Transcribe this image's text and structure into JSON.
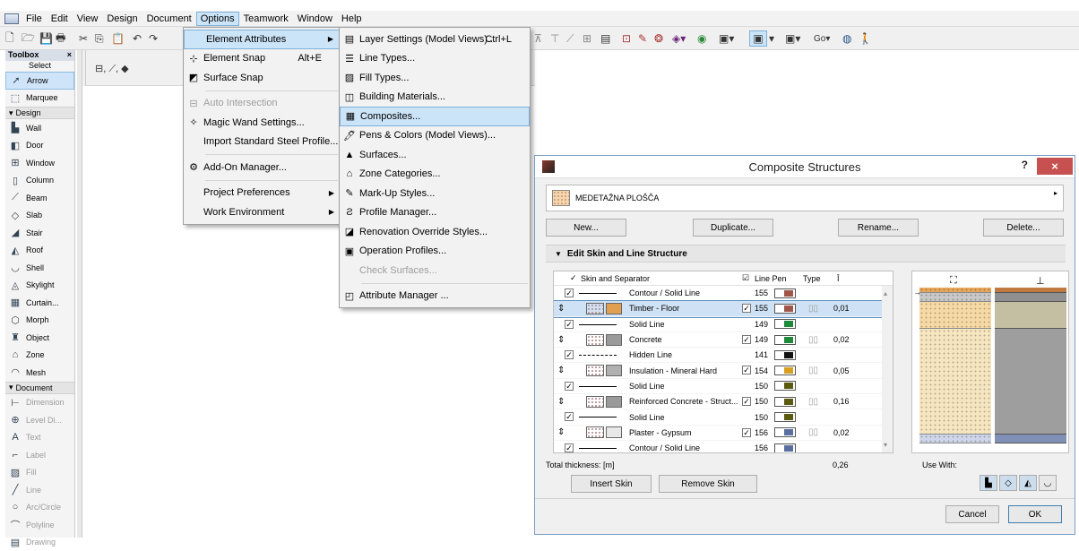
{
  "menubar": {
    "items": [
      "File",
      "Edit",
      "View",
      "Design",
      "Document",
      "Options",
      "Teamwork",
      "Window",
      "Help"
    ]
  },
  "toolbox": {
    "title": "Toolbox",
    "select": "Select",
    "items": [
      {
        "label": "Arrow",
        "sel": true
      },
      {
        "label": "Marquee"
      }
    ],
    "design_header": "Design",
    "design": [
      "Wall",
      "Door",
      "Window",
      "Column",
      "Beam",
      "Slab",
      "Stair",
      "Roof",
      "Shell",
      "Skylight",
      "Curtain...",
      "Morph",
      "Object",
      "Zone",
      "Mesh"
    ],
    "document_header": "Document",
    "document": [
      "Dimension",
      "Level Di...",
      "Text",
      "Label",
      "Fill",
      "Line",
      "Arc/Circle",
      "Polyline",
      "Drawing"
    ]
  },
  "options_menu": [
    {
      "label": "Element Attributes",
      "submenu": true,
      "hl": true
    },
    {
      "label": "Element Snap",
      "shortcut": "Alt+E"
    },
    {
      "label": "Surface Snap"
    },
    {
      "sep": true
    },
    {
      "label": "Auto Intersection",
      "dis": true
    },
    {
      "label": "Magic Wand Settings..."
    },
    {
      "label": "Import Standard Steel Profile..."
    },
    {
      "sep": true
    },
    {
      "label": "Add-On Manager..."
    },
    {
      "sep": true
    },
    {
      "label": "Project Preferences",
      "submenu": true
    },
    {
      "label": "Work Environment",
      "submenu": true
    }
  ],
  "attributes_menu": [
    {
      "label": "Layer Settings (Model Views)...",
      "shortcut": "Ctrl+L"
    },
    {
      "label": "Line Types..."
    },
    {
      "label": "Fill Types..."
    },
    {
      "label": "Building Materials..."
    },
    {
      "label": "Composites...",
      "hl": true
    },
    {
      "label": "Pens & Colors (Model Views)..."
    },
    {
      "label": "Surfaces..."
    },
    {
      "label": "Zone Categories..."
    },
    {
      "label": "Mark-Up Styles..."
    },
    {
      "label": "Profile Manager..."
    },
    {
      "label": "Renovation Override Styles..."
    },
    {
      "label": "Operation Profiles..."
    },
    {
      "label": "Check Surfaces...",
      "dis": true
    },
    {
      "sep": true
    },
    {
      "label": "Attribute Manager ..."
    }
  ],
  "toolbar": {
    "go_label": "Go"
  },
  "dialog": {
    "title": "Composite Structures",
    "help": "?",
    "close": "×",
    "composite_name": "MEDETAŽNA PLOŠČA",
    "buttons": {
      "new": "New...",
      "duplicate": "Duplicate...",
      "rename": "Rename...",
      "delete": "Delete..."
    },
    "section": "Edit Skin and Line Structure",
    "headers": {
      "skin": "Skin and Separator",
      "linepen": "Line Pen",
      "type": "Type",
      "thick": "Ī"
    },
    "rows": [
      {
        "kind": "line",
        "label": "Contour / Solid Line",
        "pen": "155",
        "color": "#a0564a"
      },
      {
        "kind": "skin",
        "label": "Timber - Floor",
        "pen": "155",
        "color": "#a0564a",
        "fillcolor": "#e0a050",
        "thick": "0,01",
        "hl": true
      },
      {
        "kind": "line",
        "label": "Solid Line",
        "pen": "149",
        "color": "#1f8a3a"
      },
      {
        "kind": "skin",
        "label": "Concrete",
        "pen": "149",
        "color": "#1f8a3a",
        "fillcolor": "#9a9a9a",
        "thick": "0,02"
      },
      {
        "kind": "dash",
        "label": "Hidden Line",
        "pen": "141",
        "color": "#111111"
      },
      {
        "kind": "skin",
        "label": "Insulation - Mineral Hard",
        "pen": "154",
        "color": "#d7a020",
        "fillcolor": "#b0b0b0",
        "thick": "0,05"
      },
      {
        "kind": "line",
        "label": "Solid Line",
        "pen": "150",
        "color": "#5a5a10"
      },
      {
        "kind": "skin",
        "label": "Reinforced Concrete - Struct...",
        "pen": "150",
        "color": "#5a5a10",
        "fillcolor": "#9a9a9a",
        "thick": "0,16"
      },
      {
        "kind": "line",
        "label": "Solid Line",
        "pen": "150",
        "color": "#5a5a10"
      },
      {
        "kind": "skin",
        "label": "Plaster - Gypsum",
        "pen": "156",
        "color": "#5a6fa0",
        "fillcolor": "#e8e8e8",
        "thick": "0,02"
      },
      {
        "kind": "line",
        "label": "Contour / Solid Line",
        "pen": "156",
        "color": "#5a6fa0"
      }
    ],
    "total_label": "Total thickness: [m]",
    "total_value": "0,26",
    "use_with": "Use With:",
    "insert": "Insert Skin",
    "remove": "Remove Skin",
    "cancel": "Cancel",
    "ok": "OK"
  }
}
